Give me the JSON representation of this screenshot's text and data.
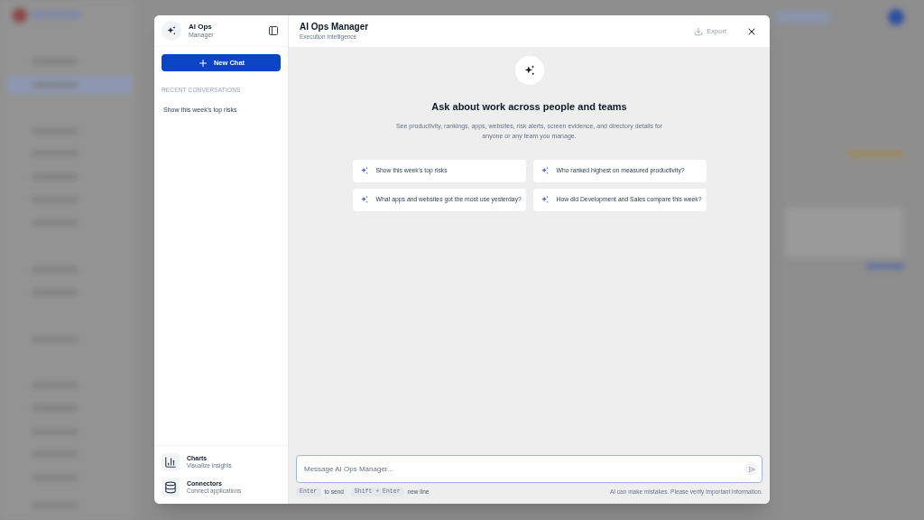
{
  "sidebar": {
    "title": "AI Ops",
    "subtitle": "Manager",
    "new_chat": "New Chat",
    "recent_heading": "RECENT CONVERSATIONS",
    "recent": [
      "Show this week's top risks"
    ],
    "tools": [
      {
        "kind": "charts",
        "title": "Charts",
        "subtitle": "Visualize insights"
      },
      {
        "kind": "connectors",
        "title": "Connectors",
        "subtitle": "Connect applications"
      }
    ]
  },
  "header": {
    "title": "AI Ops Manager",
    "subtitle": "Execution Intelligence",
    "export": "Export"
  },
  "welcome": {
    "heading": "Ask about work across people and teams",
    "description": "See productivity, rankings, apps, websites, risk alerts, screen evidence, and directory details for anyone or any team you manage."
  },
  "suggestions": [
    "Show this week's top risks",
    "Who ranked highest on measured productivity?",
    "What apps and websites got the most use yesterday?",
    "How did Development and Sales compare this week?"
  ],
  "composer": {
    "placeholder": "Message AI Ops Manager...",
    "hints": [
      {
        "key": "Enter",
        "label": "to send"
      },
      {
        "key": "Shift + Enter",
        "label": "new line"
      }
    ],
    "disclaimer": "AI can make mistakes. Please verify important information."
  }
}
